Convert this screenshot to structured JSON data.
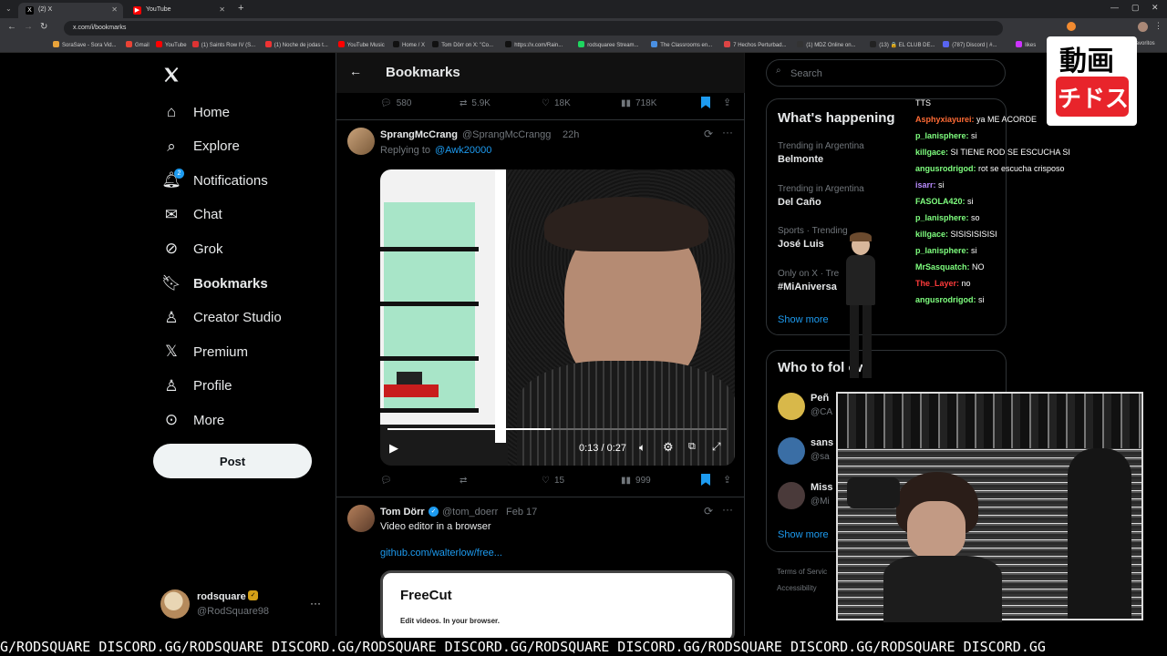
{
  "browser": {
    "tabs": [
      {
        "label": "(2) X",
        "favicon": "x-logo-icon"
      },
      {
        "label": "YouTube",
        "favicon": "youtube-icon"
      }
    ],
    "new_tab": "+",
    "url": "x.com/i/bookmarks",
    "bookmarks": [
      "SoraSave - Sora Vid...",
      "Gmail",
      "YouTube",
      "(1) Saints Row IV (S...",
      "(1) Noche de jodas t...",
      "YouTube Music",
      "Home / X",
      "Tom Dörr on X: \"Co...",
      "https://x.com/Rain...",
      "rodsquaree Stream...",
      "The Classrooms en...",
      "7 Hechos Perturbad...",
      "(1) MDZ Online on...",
      "(13) 🔒 EL CLUB DE...",
      "(787) Discord | #...",
      "likes"
    ],
    "other_favorites": "favoritos"
  },
  "sidebar": {
    "nav": [
      {
        "label": "Home",
        "icon": "home-icon"
      },
      {
        "label": "Explore",
        "icon": "search-icon"
      },
      {
        "label": "Notifications",
        "icon": "bell-icon",
        "badge": "2"
      },
      {
        "label": "Chat",
        "icon": "mail-icon"
      },
      {
        "label": "Grok",
        "icon": "grok-icon"
      },
      {
        "label": "Bookmarks",
        "icon": "bookmark-icon"
      },
      {
        "label": "Creator Studio",
        "icon": "creator-icon"
      },
      {
        "label": "Premium",
        "icon": "x-logo-icon"
      },
      {
        "label": "Profile",
        "icon": "person-icon"
      },
      {
        "label": "More",
        "icon": "more-circle-icon"
      }
    ],
    "post_label": "Post",
    "account": {
      "name": "rodsquare",
      "handle": "@RodSquare98",
      "more": "···"
    }
  },
  "main": {
    "title": "Bookmarks",
    "prev_actions": {
      "replies": "580",
      "reposts": "5.9K",
      "likes": "18K",
      "views": "718K"
    },
    "tweet1": {
      "name": "SprangMcCrang",
      "handle": "@SprangMcCrangg",
      "time": "22h",
      "replying_prefix": "Replying to",
      "replying_to": "@Awk20000",
      "video_time": "0:13 / 0:27",
      "progress": 0.48,
      "actions": {
        "replies": "",
        "reposts": "",
        "likes": "15",
        "views": "999"
      }
    },
    "tweet2": {
      "name": "Tom Dörr",
      "handle": "@tom_doerr",
      "time": "Feb 17",
      "text": "Video editor in a browser",
      "link": "github.com/walterlow/free...",
      "card_title": "FreeCut",
      "card_sub": "Edit videos. In your browser."
    }
  },
  "right": {
    "search_placeholder": "Search",
    "whats_happening": "What's happening",
    "trends": [
      {
        "meta": "Trending in Argentina",
        "name": "Belmonte"
      },
      {
        "meta": "Trending in Argentina",
        "name": "Del Caño"
      },
      {
        "meta": "Sports · Trending",
        "name": "José Luis"
      },
      {
        "meta": "Only on X · Tre",
        "name": "#MiAniversa"
      }
    ],
    "show_more": "Show more",
    "who_to_follow": "Who to fol ow",
    "follow": [
      {
        "name": "Peñ",
        "handle": "@CA"
      },
      {
        "name": "sans",
        "handle": "@sa"
      },
      {
        "name": "Miss",
        "handle": "@Mi"
      }
    ],
    "footer": [
      "Terms of Servic",
      "Accessibility"
    ]
  },
  "chat": [
    {
      "user": "",
      "text": "TTS",
      "color": "#ffffff"
    },
    {
      "user": "Asphyxiayurei:",
      "text": "ya ME ACORDE",
      "color": "#ff6b35"
    },
    {
      "user": "p_lanisphere:",
      "text": "si",
      "color": "#7fff7f"
    },
    {
      "user": "killgace:",
      "text": "SI TIENE ROD SE ESCUCHA SI",
      "color": "#7fff7f"
    },
    {
      "user": "angusrodrigod:",
      "text": "rot se escucha crisposo",
      "color": "#7fff7f"
    },
    {
      "user": "isarr:",
      "text": "si",
      "color": "#b98cff"
    },
    {
      "user": "FASOLA420:",
      "text": "si",
      "color": "#7fff7f"
    },
    {
      "user": "p_lanisphere:",
      "text": "so",
      "color": "#7fff7f"
    },
    {
      "user": "killgace:",
      "text": "SISISISISISI",
      "color": "#7fff7f"
    },
    {
      "user": "p_lanisphere:",
      "text": "si",
      "color": "#7fff7f"
    },
    {
      "user": "MrSasquatch:",
      "text": "NO",
      "color": "#7fff7f"
    },
    {
      "user": "The_Layer:",
      "text": "no",
      "color": "#ff3b3b"
    },
    {
      "user": "angusrodrigod:",
      "text": "si",
      "color": "#7fff7f"
    }
  ],
  "logo": {
    "top": "動画",
    "bottom": "チドス"
  },
  "ticker": "G/RODSQUARE DISCORD.GG/RODSQUARE DISCORD.GG/RODSQUARE DISCORD.GG/RODSQUARE DISCORD.GG/RODSQUARE DISCORD.GG/RODSQUARE DISCORD.GG"
}
